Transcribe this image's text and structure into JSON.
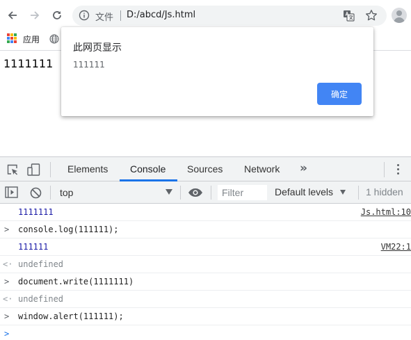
{
  "browser": {
    "omnibox": {
      "scheme_label": "文件",
      "url": "D:/abcd/Js.html"
    },
    "bookmarks": {
      "apps_label": "应用"
    },
    "icons": [
      "back-arrow-icon",
      "forward-arrow-icon",
      "reload-icon",
      "info-icon",
      "translate-icon",
      "star-icon",
      "profile-icon",
      "apps-grid-icon",
      "globe-icon"
    ]
  },
  "page": {
    "text": "1111111"
  },
  "dialog": {
    "title": "此网页显示",
    "message": "111111",
    "ok_label": "确定",
    "ok_color": "#4285f4"
  },
  "devtools": {
    "tabs": [
      "Elements",
      "Console",
      "Sources",
      "Network"
    ],
    "active_tab": "Console",
    "more_tabs": "»",
    "context": "top",
    "filter_placeholder": "Filter",
    "levels": "Default levels",
    "hidden": "1 hidden",
    "accent_color": "#1a73e8",
    "console": [
      {
        "kind": "log",
        "text": "1111111",
        "source": "Js.html:10"
      },
      {
        "kind": "input",
        "glyph": ">",
        "text": "console.log(111111);"
      },
      {
        "kind": "log",
        "text": "111111",
        "source": "VM22:1"
      },
      {
        "kind": "result",
        "glyph": "<·",
        "text": "undefined"
      },
      {
        "kind": "input",
        "glyph": ">",
        "text": "document.write(1111111)"
      },
      {
        "kind": "result",
        "glyph": "<·",
        "text": "undefined"
      },
      {
        "kind": "input",
        "glyph": ">",
        "text": " window.alert(111111);"
      },
      {
        "kind": "prompt",
        "glyph": ">",
        "text": ""
      }
    ]
  }
}
